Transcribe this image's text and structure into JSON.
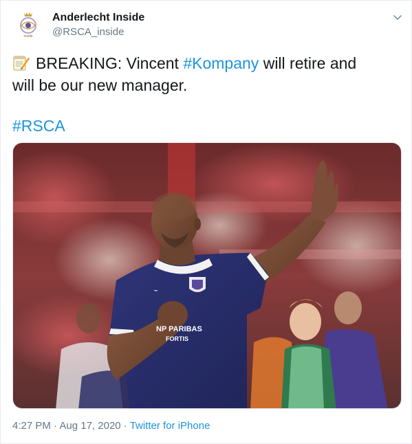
{
  "author": {
    "name": "Anderlecht Inside",
    "handle": "@RSCA_inside",
    "avatar_icon": "rsca-crest-icon",
    "avatar_text": "inside"
  },
  "tweet": {
    "emoji_icon": "memo-pencil-icon",
    "line1_prefix": "BREAKING: Vincent ",
    "line1_hashtag": "#Kompany",
    "line1_suffix": " will retire and",
    "line2": "will be our new manager.",
    "hashtag": "#RSCA"
  },
  "media": {
    "shirt_sponsor_line1": "NP PARIBAS",
    "shirt_sponsor_line2": "FORTIS"
  },
  "footer": {
    "time": "4:27 PM",
    "separator1": " · ",
    "date": "Aug 17, 2020",
    "separator2": " · ",
    "source": "Twitter for iPhone"
  },
  "colors": {
    "link": "#1b95e0",
    "secondary_text": "#657786",
    "primary_text": "#14171a",
    "jersey": "#2a2f6e"
  }
}
